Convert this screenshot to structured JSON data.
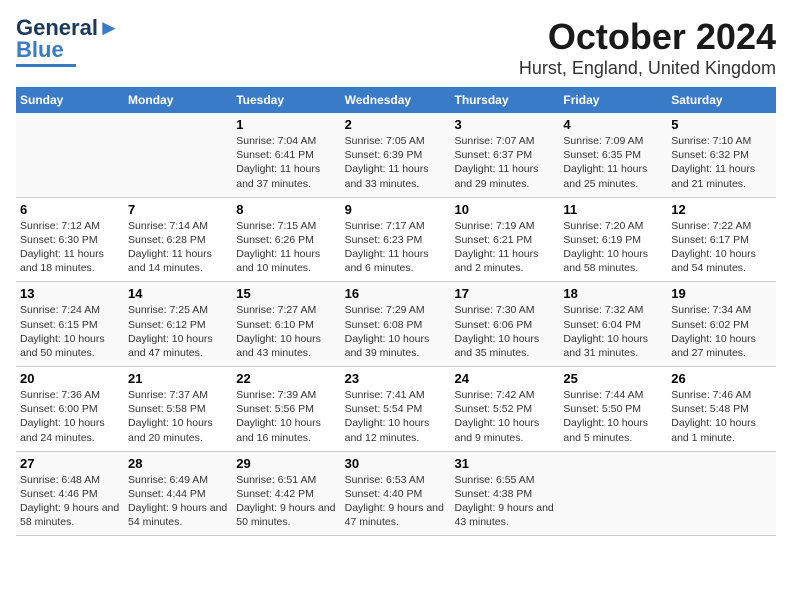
{
  "logo": {
    "line1": "General",
    "line2": "Blue"
  },
  "title": "October 2024",
  "subtitle": "Hurst, England, United Kingdom",
  "days_of_week": [
    "Sunday",
    "Monday",
    "Tuesday",
    "Wednesday",
    "Thursday",
    "Friday",
    "Saturday"
  ],
  "weeks": [
    [
      {
        "day": "",
        "content": ""
      },
      {
        "day": "",
        "content": ""
      },
      {
        "day": "1",
        "content": "Sunrise: 7:04 AM\nSunset: 6:41 PM\nDaylight: 11 hours and 37 minutes."
      },
      {
        "day": "2",
        "content": "Sunrise: 7:05 AM\nSunset: 6:39 PM\nDaylight: 11 hours and 33 minutes."
      },
      {
        "day": "3",
        "content": "Sunrise: 7:07 AM\nSunset: 6:37 PM\nDaylight: 11 hours and 29 minutes."
      },
      {
        "day": "4",
        "content": "Sunrise: 7:09 AM\nSunset: 6:35 PM\nDaylight: 11 hours and 25 minutes."
      },
      {
        "day": "5",
        "content": "Sunrise: 7:10 AM\nSunset: 6:32 PM\nDaylight: 11 hours and 21 minutes."
      }
    ],
    [
      {
        "day": "6",
        "content": "Sunrise: 7:12 AM\nSunset: 6:30 PM\nDaylight: 11 hours and 18 minutes."
      },
      {
        "day": "7",
        "content": "Sunrise: 7:14 AM\nSunset: 6:28 PM\nDaylight: 11 hours and 14 minutes."
      },
      {
        "day": "8",
        "content": "Sunrise: 7:15 AM\nSunset: 6:26 PM\nDaylight: 11 hours and 10 minutes."
      },
      {
        "day": "9",
        "content": "Sunrise: 7:17 AM\nSunset: 6:23 PM\nDaylight: 11 hours and 6 minutes."
      },
      {
        "day": "10",
        "content": "Sunrise: 7:19 AM\nSunset: 6:21 PM\nDaylight: 11 hours and 2 minutes."
      },
      {
        "day": "11",
        "content": "Sunrise: 7:20 AM\nSunset: 6:19 PM\nDaylight: 10 hours and 58 minutes."
      },
      {
        "day": "12",
        "content": "Sunrise: 7:22 AM\nSunset: 6:17 PM\nDaylight: 10 hours and 54 minutes."
      }
    ],
    [
      {
        "day": "13",
        "content": "Sunrise: 7:24 AM\nSunset: 6:15 PM\nDaylight: 10 hours and 50 minutes."
      },
      {
        "day": "14",
        "content": "Sunrise: 7:25 AM\nSunset: 6:12 PM\nDaylight: 10 hours and 47 minutes."
      },
      {
        "day": "15",
        "content": "Sunrise: 7:27 AM\nSunset: 6:10 PM\nDaylight: 10 hours and 43 minutes."
      },
      {
        "day": "16",
        "content": "Sunrise: 7:29 AM\nSunset: 6:08 PM\nDaylight: 10 hours and 39 minutes."
      },
      {
        "day": "17",
        "content": "Sunrise: 7:30 AM\nSunset: 6:06 PM\nDaylight: 10 hours and 35 minutes."
      },
      {
        "day": "18",
        "content": "Sunrise: 7:32 AM\nSunset: 6:04 PM\nDaylight: 10 hours and 31 minutes."
      },
      {
        "day": "19",
        "content": "Sunrise: 7:34 AM\nSunset: 6:02 PM\nDaylight: 10 hours and 27 minutes."
      }
    ],
    [
      {
        "day": "20",
        "content": "Sunrise: 7:36 AM\nSunset: 6:00 PM\nDaylight: 10 hours and 24 minutes."
      },
      {
        "day": "21",
        "content": "Sunrise: 7:37 AM\nSunset: 5:58 PM\nDaylight: 10 hours and 20 minutes."
      },
      {
        "day": "22",
        "content": "Sunrise: 7:39 AM\nSunset: 5:56 PM\nDaylight: 10 hours and 16 minutes."
      },
      {
        "day": "23",
        "content": "Sunrise: 7:41 AM\nSunset: 5:54 PM\nDaylight: 10 hours and 12 minutes."
      },
      {
        "day": "24",
        "content": "Sunrise: 7:42 AM\nSunset: 5:52 PM\nDaylight: 10 hours and 9 minutes."
      },
      {
        "day": "25",
        "content": "Sunrise: 7:44 AM\nSunset: 5:50 PM\nDaylight: 10 hours and 5 minutes."
      },
      {
        "day": "26",
        "content": "Sunrise: 7:46 AM\nSunset: 5:48 PM\nDaylight: 10 hours and 1 minute."
      }
    ],
    [
      {
        "day": "27",
        "content": "Sunrise: 6:48 AM\nSunset: 4:46 PM\nDaylight: 9 hours and 58 minutes."
      },
      {
        "day": "28",
        "content": "Sunrise: 6:49 AM\nSunset: 4:44 PM\nDaylight: 9 hours and 54 minutes."
      },
      {
        "day": "29",
        "content": "Sunrise: 6:51 AM\nSunset: 4:42 PM\nDaylight: 9 hours and 50 minutes."
      },
      {
        "day": "30",
        "content": "Sunrise: 6:53 AM\nSunset: 4:40 PM\nDaylight: 9 hours and 47 minutes."
      },
      {
        "day": "31",
        "content": "Sunrise: 6:55 AM\nSunset: 4:38 PM\nDaylight: 9 hours and 43 minutes."
      },
      {
        "day": "",
        "content": ""
      },
      {
        "day": "",
        "content": ""
      }
    ]
  ]
}
